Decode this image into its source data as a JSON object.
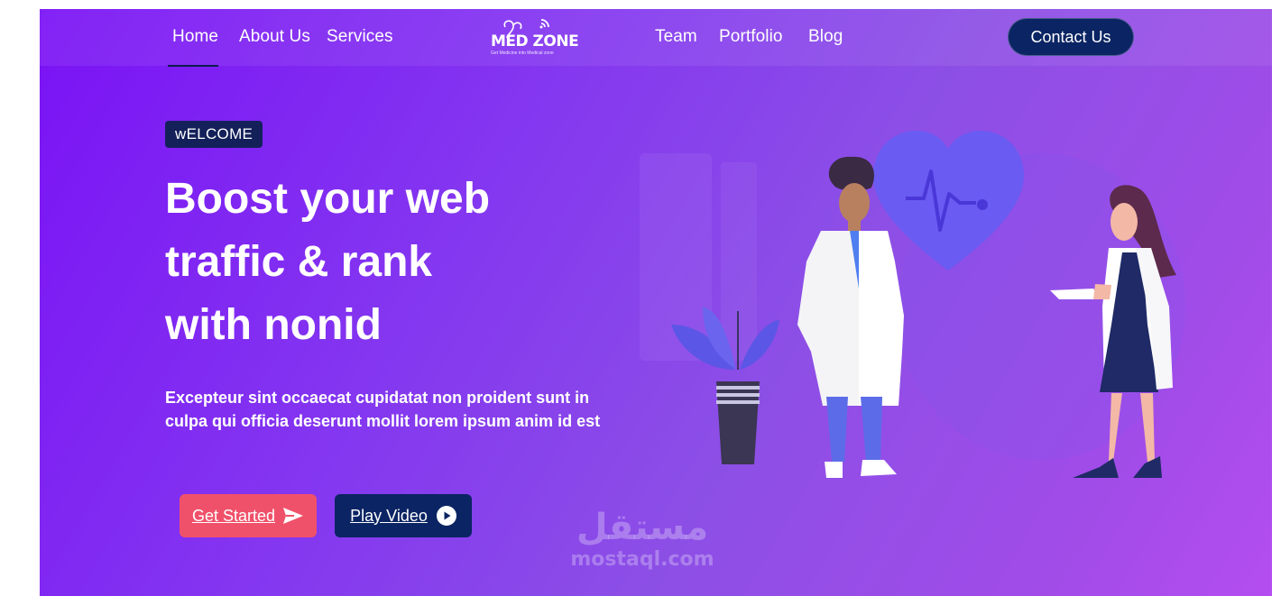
{
  "nav": {
    "left_links": [
      {
        "label": "Home"
      },
      {
        "label": "About Us"
      },
      {
        "label": "Services"
      }
    ],
    "right_links": [
      {
        "label": "Team"
      },
      {
        "label": "Portfolio"
      },
      {
        "label": "Blog"
      }
    ],
    "active": "Home",
    "logo": {
      "text": "MED ZONE",
      "tagline": "Get Medicine into Medical zone"
    },
    "contact_label": "Contact Us"
  },
  "hero": {
    "badge": "wELCOME",
    "headline_lines": [
      "Boost your web",
      "traffic & rank",
      "with nonid"
    ],
    "description": "Excepteur sint occaecat cupidatat non proident sunt in culpa qui officia deserunt mollit lorem ipsum anim id est",
    "primary_button": {
      "label": "Get Started",
      "icon": "paper-plane-icon"
    },
    "secondary_button": {
      "label": "Play Video",
      "icon": "play-circle-icon"
    }
  },
  "watermark": {
    "arabic": "مستقل",
    "latin": "mostaql.com"
  },
  "colors": {
    "gradient_start": "#7a12f5",
    "gradient_end": "#b44df0",
    "navy": "#0b2463",
    "coral": "#f0516a"
  }
}
